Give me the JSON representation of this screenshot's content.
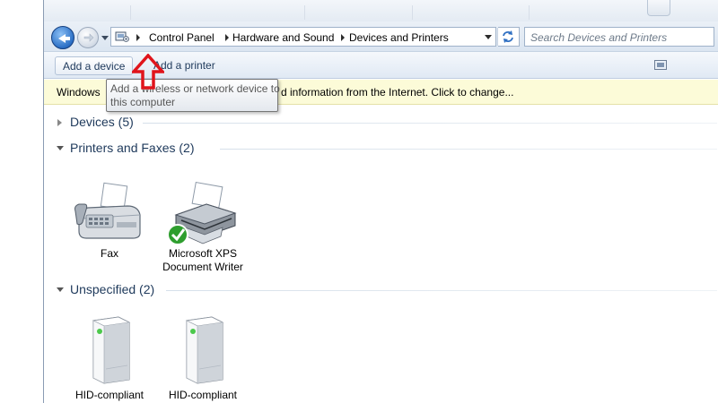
{
  "address_bar": {
    "breadcrumbs": [
      "Control Panel",
      "Hardware and Sound",
      "Devices and Printers"
    ],
    "search_placeholder": "Search Devices and Printers"
  },
  "toolbar": {
    "add_device_label": "Add a device",
    "add_printer_label": "Add a printer"
  },
  "info_bar": {
    "text_left": "Windows",
    "text_right": "d information from the Internet. Click to change..."
  },
  "tooltip": {
    "line1": "Add a wireless or network device to",
    "line2": "this computer"
  },
  "groups": {
    "devices": {
      "title": "Devices (5)"
    },
    "printers": {
      "title": "Printers and Faxes (2)",
      "items": [
        {
          "line1": "Fax",
          "line2": ""
        },
        {
          "line1": "Microsoft XPS",
          "line2": "Document Writer"
        }
      ]
    },
    "unspecified": {
      "title": "Unspecified (2)",
      "items": [
        {
          "line1": "HID-compliant"
        },
        {
          "line1": "HID-compliant"
        }
      ]
    }
  },
  "colors": {
    "accent_text": "#1e395b",
    "info_bar_bg": "#fcfbd8",
    "annotation_arrow": "#e0141b",
    "default_check": "#2e9e2e"
  },
  "icons": {
    "back": "back-arrow-icon",
    "forward": "forward-arrow-icon",
    "refresh": "refresh-icon",
    "control_panel": "control-panel-icon",
    "fax": "fax-machine-icon",
    "printer": "printer-icon",
    "default_printer": "green-check-icon",
    "hid": "hid-device-icon",
    "view": "change-view-icon"
  }
}
